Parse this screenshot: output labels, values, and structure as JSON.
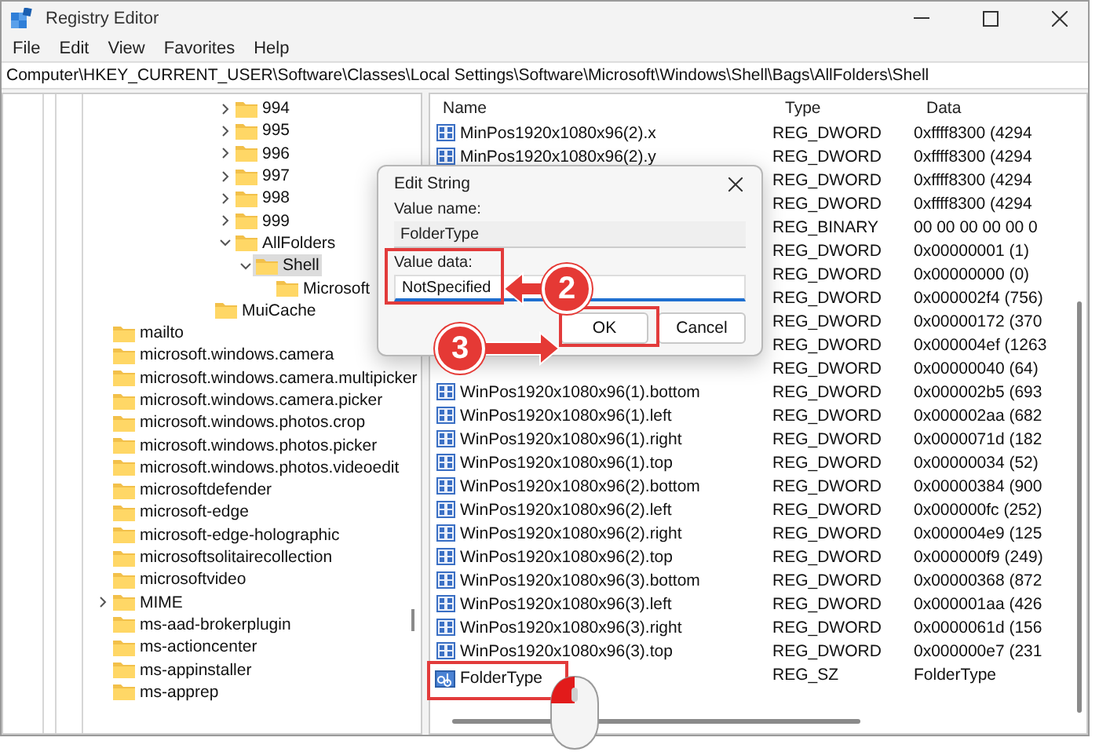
{
  "window": {
    "title": "Registry Editor"
  },
  "menu": [
    "File",
    "Edit",
    "View",
    "Favorites",
    "Help"
  ],
  "address": "Computer\\HKEY_CURRENT_USER\\Software\\Classes\\Local Settings\\Software\\Microsoft\\Windows\\Shell\\Bags\\AllFolders\\Shell",
  "tree": [
    {
      "children": [
        {
          "children": [
            {
              "children": [
                {
                  "children": [
                    {
                      "children": [
                        {
                          "children": [
                            {
                              "label": "994",
                              "expanded": false,
                              "selected": false
                            },
                            {
                              "label": "995",
                              "expanded": false,
                              "selected": false
                            },
                            {
                              "label": "996",
                              "expanded": false,
                              "selected": false
                            },
                            {
                              "label": "997",
                              "expanded": false,
                              "selected": false
                            },
                            {
                              "label": "998",
                              "expanded": false,
                              "selected": false
                            },
                            {
                              "label": "999",
                              "expanded": false,
                              "selected": false
                            },
                            {
                              "label": "AllFolders",
                              "expanded": true,
                              "selected": false,
                              "children": [
                                {
                                  "label": "Shell",
                                  "expanded": true,
                                  "selected": true,
                                  "children": [
                                    {
                                      "label": "Microsoft",
                                      "selected": false
                                    }
                                  ]
                                }
                              ]
                            }
                          ]
                        },
                        {
                          "label": "MuiCache",
                          "selected": false
                        }
                      ]
                    }
                  ]
                }
              ]
            }
          ]
        }
      ]
    },
    {
      "label": "mailto",
      "selected": false
    },
    {
      "label": "microsoft.windows.camera",
      "selected": false
    },
    {
      "label": "microsoft.windows.camera.multipicker",
      "selected": false
    },
    {
      "label": "microsoft.windows.camera.picker",
      "selected": false
    },
    {
      "label": "microsoft.windows.photos.crop",
      "selected": false
    },
    {
      "label": "microsoft.windows.photos.picker",
      "selected": false
    },
    {
      "label": "microsoft.windows.photos.videoedit",
      "selected": false
    },
    {
      "label": "microsoftdefender",
      "selected": false
    },
    {
      "label": "microsoft-edge",
      "selected": false
    },
    {
      "label": "microsoft-edge-holographic",
      "selected": false
    },
    {
      "label": "microsoftsolitairecollection",
      "selected": false
    },
    {
      "label": "microsoftvideo",
      "selected": false
    },
    {
      "label": "MIME",
      "expanded": false,
      "selected": false
    },
    {
      "label": "ms-aad-brokerplugin",
      "selected": false
    },
    {
      "label": "ms-actioncenter",
      "selected": false
    },
    {
      "label": "ms-appinstaller",
      "selected": false
    },
    {
      "label": "ms-apprep",
      "selected": false
    }
  ],
  "columns": [
    "Name",
    "Type",
    "Data"
  ],
  "rows": [
    {
      "kind": "dword",
      "name": "MinPos1920x1080x96(2).x",
      "type": "REG_DWORD",
      "data": "0xffff8300 (4294",
      "highlighted": false
    },
    {
      "kind": "dword",
      "name": "MinPos1920x1080x96(2).y",
      "type": "REG_DWORD",
      "data": "0xffff8300 (4294",
      "highlighted": false
    },
    {
      "type": "REG_DWORD",
      "data": "0xffff8300 (4294",
      "highlighted": false
    },
    {
      "type": "REG_DWORD",
      "data": "0xffff8300 (4294",
      "highlighted": false
    },
    {
      "type": "REG_BINARY",
      "data": "00 00 00 00 00 0",
      "highlighted": false
    },
    {
      "type": "REG_DWORD",
      "data": "0x00000001 (1)",
      "highlighted": false
    },
    {
      "type": "REG_DWORD",
      "data": "0x00000000 (0)",
      "highlighted": false
    },
    {
      "type": "REG_DWORD",
      "data": "0x000002f4 (756)",
      "highlighted": false
    },
    {
      "type": "REG_DWORD",
      "data": "0x00000172 (370",
      "highlighted": false
    },
    {
      "type": "REG_DWORD",
      "data": "0x000004ef (1263",
      "highlighted": false
    },
    {
      "type": "REG_DWORD",
      "data": "0x00000040 (64)",
      "highlighted": false
    },
    {
      "kind": "dword",
      "name": "WinPos1920x1080x96(1).bottom",
      "type": "REG_DWORD",
      "data": "0x000002b5 (693",
      "highlighted": false
    },
    {
      "kind": "dword",
      "name": "WinPos1920x1080x96(1).left",
      "type": "REG_DWORD",
      "data": "0x000002aa (682",
      "highlighted": false
    },
    {
      "kind": "dword",
      "name": "WinPos1920x1080x96(1).right",
      "type": "REG_DWORD",
      "data": "0x0000071d (182",
      "highlighted": false
    },
    {
      "kind": "dword",
      "name": "WinPos1920x1080x96(1).top",
      "type": "REG_DWORD",
      "data": "0x00000034 (52)",
      "highlighted": false
    },
    {
      "kind": "dword",
      "name": "WinPos1920x1080x96(2).bottom",
      "type": "REG_DWORD",
      "data": "0x00000384 (900",
      "highlighted": false
    },
    {
      "kind": "dword",
      "name": "WinPos1920x1080x96(2).left",
      "type": "REG_DWORD",
      "data": "0x000000fc (252)",
      "highlighted": false
    },
    {
      "kind": "dword",
      "name": "WinPos1920x1080x96(2).right",
      "type": "REG_DWORD",
      "data": "0x000004e9 (125",
      "highlighted": false
    },
    {
      "kind": "dword",
      "name": "WinPos1920x1080x96(2).top",
      "type": "REG_DWORD",
      "data": "0x000000f9 (249)",
      "highlighted": false
    },
    {
      "kind": "dword",
      "name": "WinPos1920x1080x96(3).bottom",
      "type": "REG_DWORD",
      "data": "0x00000368 (872",
      "highlighted": false
    },
    {
      "kind": "dword",
      "name": "WinPos1920x1080x96(3).left",
      "type": "REG_DWORD",
      "data": "0x000001aa (426",
      "highlighted": false
    },
    {
      "kind": "dword",
      "name": "WinPos1920x1080x96(3).right",
      "type": "REG_DWORD",
      "data": "0x0000061d (156",
      "highlighted": false
    },
    {
      "kind": "dword",
      "name": "WinPos1920x1080x96(3).top",
      "type": "REG_DWORD",
      "data": "0x000000e7 (231",
      "highlighted": false
    },
    {
      "kind": "string",
      "name": "FolderType",
      "type": "REG_SZ",
      "data": "FolderType",
      "highlighted": true
    }
  ],
  "dialog": {
    "title": "Edit String",
    "value_name_label": "Value name:",
    "value_name": "FolderType",
    "value_data_label": "Value data:",
    "value_data": "NotSpecified",
    "value_data_highlighted": true,
    "buttons": [
      {
        "label": "OK",
        "highlighted": true
      },
      {
        "label": "Cancel",
        "highlighted": false
      }
    ]
  },
  "callouts": [
    {
      "number": "2",
      "kind": "left"
    },
    {
      "number": "3",
      "kind": "right"
    }
  ]
}
